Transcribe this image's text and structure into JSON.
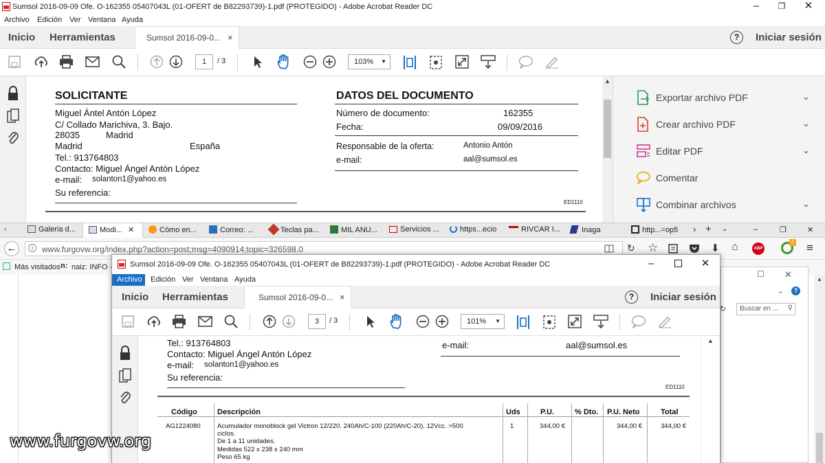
{
  "back_window": {
    "title": "Sumsol 2016-09-09 Ofe. O-162355 05407043L (01-OFERT de B82293739)-1.pdf (PROTEGIDO) - Adobe Acrobat Reader DC",
    "menu": [
      "Archivo",
      "Edición",
      "Ver",
      "Ventana",
      "Ayuda"
    ],
    "tabs": {
      "home": "Inicio",
      "tools": "Herramientas",
      "doc": "Sumsol 2016-09-0...",
      "close": "×",
      "help": "?",
      "signin": "Iniciar sesión"
    },
    "page_current": "1",
    "page_total": "/ 3",
    "zoom": "103%",
    "right_panel": [
      "Exportar archivo PDF",
      "Crear archivo PDF",
      "Editar PDF",
      "Comentar",
      "Combinar archivos"
    ],
    "doc": {
      "solicitante_h": "SOLICITANTE",
      "name": "Miguel Ántel Antón López",
      "addr": "C/ Collado Marichiva, 3. Bajo.",
      "cp": "28035",
      "city": "Madrid",
      "prov": "Madrid",
      "country": "España",
      "tel": "Tel.: 913764803",
      "contact": "Contacto: Miguel Ángel Antón López",
      "email_l": "e-mail:",
      "email_v": "solanton1@yahoo.es",
      "ref": "Su referencia:",
      "datos_h": "DATOS DEL DOCUMENTO",
      "num_l": "Número de documento:",
      "num_v": "162355",
      "fecha_l": "Fecha:",
      "fecha_v": "09/09/2016",
      "resp_l": "Responsable de la oferta:",
      "resp_v": "Antonio Antón",
      "em_l": "e-mail:",
      "em_v": "aal@sumsol.es",
      "code": "ED1110"
    }
  },
  "firefox": {
    "tabs": [
      "Galeria d...",
      "Modi...",
      "Cómo en...",
      "Correo: ...",
      "Teclas pa...",
      "MIL ANU...",
      "Servicios ...",
      "https...ecio",
      "RIVCAR I...",
      "Inaga",
      "http...=op5"
    ],
    "url": "www.furgovw.org/index.php?action=post;msg=4090914;topic=326598.0",
    "bookmarks": [
      "Más visitados",
      "naiz: INFO -"
    ],
    "search_placeholder": "Buscar en ..."
  },
  "front_window": {
    "title": "Sumsol 2016-09-09 Ofe. O-162355 05407043L (01-OFERT de B82293739)-1.pdf (PROTEGIDO) - Adobe Acrobat Reader DC",
    "menu": [
      "Archivo",
      "Edición",
      "Ver",
      "Ventana",
      "Ayuda"
    ],
    "tabs": {
      "home": "Inicio",
      "tools": "Herramientas",
      "doc": "Sumsol 2016-09-0...",
      "close": "×",
      "help": "?",
      "signin": "Iniciar sesión"
    },
    "page_current": "3",
    "page_total": "/ 3",
    "zoom": "101%",
    "doc": {
      "tel": "Tel.: 913764803",
      "contact": "Contacto: Miguel Ángel Antón López",
      "email_l": "e-mail:",
      "email_v": "solanton1@yahoo.es",
      "ref": "Su referencia:",
      "em_l": "e-mail:",
      "em_v": "aal@sumsol.es",
      "code": "ED1110",
      "headers": [
        "Código",
        "Descripción",
        "Uds",
        "P.U.",
        "% Dto.",
        "P.U. Neto",
        "Total"
      ],
      "row": {
        "code": "AG1224080",
        "desc": [
          "Acumulador monoblock gel Victron 12/220. 240Ah/C-100 (220Ah/C-20). 12Vcc. >500",
          "ciclos.",
          "De 1 a 11 unidades.",
          "Medidas 522 x 238 x 240 mm",
          "Peso 65 kg"
        ],
        "uds": "1",
        "pu": "344,00 €",
        "neto": "344,00 €",
        "total": "344,00 €"
      }
    }
  },
  "watermark": "www.furgovw.org"
}
